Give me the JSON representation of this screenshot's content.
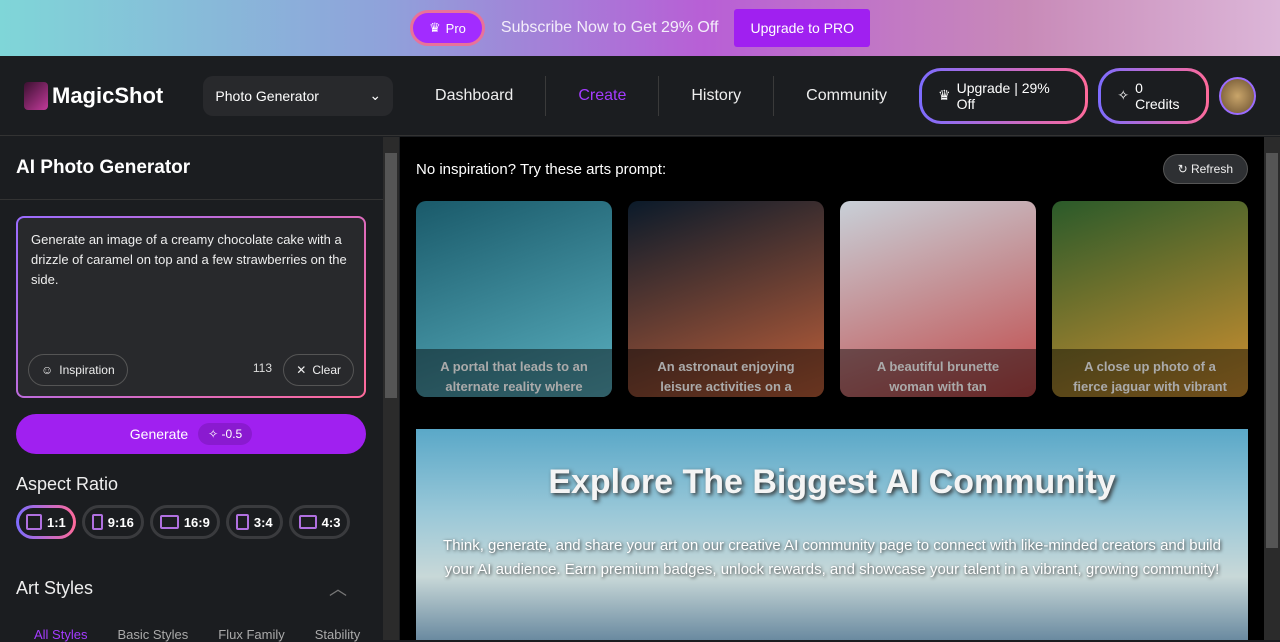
{
  "promo": {
    "pro_label": "Pro",
    "text": "Subscribe Now to Get 29% Off",
    "button": "Upgrade to PRO"
  },
  "header": {
    "logo": "MagicShot",
    "tool_select": "Photo Generator",
    "nav": [
      "Dashboard",
      "Create",
      "History",
      "Community"
    ],
    "active_nav": "Create",
    "upgrade": "Upgrade | 29% Off",
    "credits": "0 Credits"
  },
  "sidebar": {
    "title": "AI Photo Generator",
    "prompt": "Generate an image of a creamy chocolate cake with a drizzle of caramel on top and a few strawberries on the side.",
    "inspiration": "Inspiration",
    "char_count": "113",
    "clear": "Clear",
    "generate": "Generate",
    "cost": "-0.5",
    "aspect_title": "Aspect Ratio",
    "ratios": [
      "1:1",
      "9:16",
      "16:9",
      "3:4",
      "4:3"
    ],
    "selected_ratio": "1:1",
    "art_styles_title": "Art Styles",
    "style_tabs": [
      "All Styles",
      "Basic Styles",
      "Flux Family",
      "Stability"
    ]
  },
  "main": {
    "inspiration_title": "No inspiration? Try these arts prompt:",
    "refresh": "Refresh",
    "cards": [
      {
        "caption": "A portal that leads to an alternate reality where",
        "colors": [
          "#1a5a6a",
          "#5ab0c0"
        ]
      },
      {
        "caption": "An astronaut enjoying leisure activities on a",
        "colors": [
          "#0a1a2a",
          "#c0603a"
        ]
      },
      {
        "caption": "A beautiful brunette woman with tan",
        "colors": [
          "#c8d0d8",
          "#c04848"
        ]
      },
      {
        "caption": "A close up photo of a fierce jaguar with vibrant",
        "colors": [
          "#2a5a2a",
          "#d09030"
        ]
      }
    ],
    "banner_title": "Explore The Biggest AI Community",
    "banner_text": "Think, generate, and share your art on our creative AI community page to connect with like-minded creators and build your AI audience. Earn premium badges, unlock rewards, and showcase your talent in a vibrant, growing community!"
  },
  "colors": {
    "accent": "#a020f0",
    "gradient_start": "#7d6cff",
    "gradient_end": "#ff6a9a"
  }
}
